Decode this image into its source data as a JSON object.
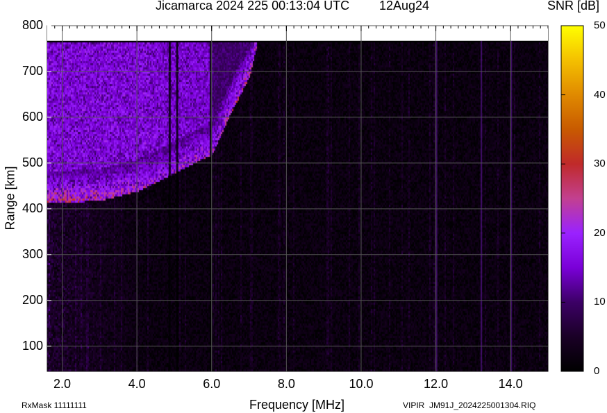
{
  "title": {
    "main": "Jicamarca 2024 225 00:13:04 UTC",
    "date": "12Aug24"
  },
  "colorbar": {
    "label": "SNR [dB]",
    "ticks": [
      "50",
      "40",
      "30",
      "20",
      "10",
      "0"
    ],
    "stops": [
      "#000000",
      "#1a0026",
      "#3c0066",
      "#7a00d8",
      "#9a22ff",
      "#c24090",
      "#c02a2a",
      "#c85a00",
      "#e08a00",
      "#f4c000",
      "#ffff00"
    ]
  },
  "footer": {
    "left": "RxMask 11111111",
    "right": "VIPIR  JM91J_2024225001304.RIQ"
  },
  "chart_data": {
    "type": "heatmap",
    "title": "Jicamarca 2024 225 00:13:04 UTC    12Aug24",
    "xlabel": "Frequency [MHz]",
    "ylabel": "Range [km]",
    "colorbar_label": "SNR [dB]",
    "xlim": [
      1.6,
      15.0
    ],
    "ylim": [
      45,
      800
    ],
    "clim": [
      0,
      50
    ],
    "x_ticks": [
      "2.0",
      "4.0",
      "6.0",
      "8.0",
      "10.0",
      "12.0",
      "14.0"
    ],
    "y_ticks": [
      "100",
      "200",
      "300",
      "400",
      "500",
      "600",
      "700",
      "800"
    ],
    "grid": true,
    "data_range_top_km": 767,
    "ionogram_trace": {
      "description_points_freq_MHz": [
        1.6,
        2.0,
        3.0,
        4.0,
        4.5,
        5.0,
        5.5,
        6.0,
        6.5,
        7.0,
        7.2
      ],
      "lower_edge_range_km": [
        425,
        425,
        430,
        450,
        470,
        490,
        510,
        530,
        620,
        700,
        767
      ],
      "peak_snr_dB": [
        22,
        24,
        22,
        20,
        18,
        20,
        22,
        20,
        22,
        24,
        20
      ]
    },
    "dark_columns_MHz": [
      4.85,
      5.05,
      5.95
    ],
    "bright_lines_MHz": [
      12.0,
      13.2,
      14.0
    ]
  }
}
